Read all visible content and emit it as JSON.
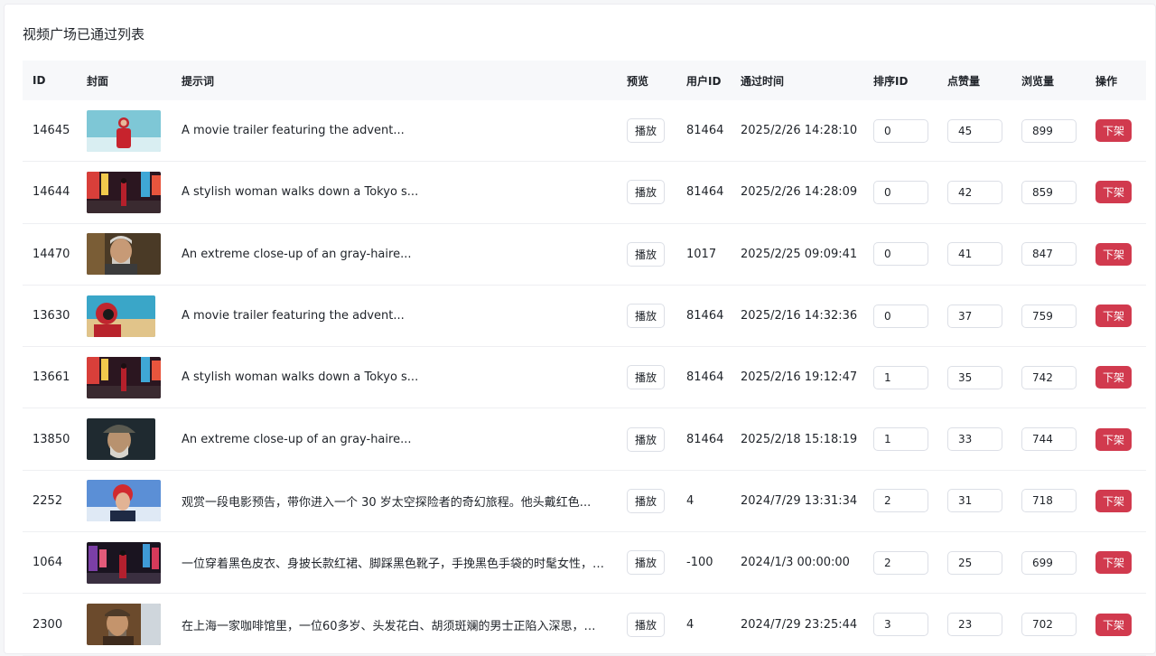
{
  "page": {
    "title": "视频广场已通过列表"
  },
  "table": {
    "headers": [
      "ID",
      "封面",
      "提示词",
      "预览",
      "用户ID",
      "通过时间",
      "排序ID",
      "点赞量",
      "浏览量",
      "操作"
    ],
    "play_label": "播放",
    "takedown_label": "下架",
    "rows": [
      {
        "id": "14645",
        "prompt": "A movie trailer featuring the advent...",
        "user_id": "81464",
        "time": "2025/2/26 14:28:10",
        "order": "0",
        "likes": "45",
        "views": "899",
        "thumb": "astronaut-snow"
      },
      {
        "id": "14644",
        "prompt": "A stylish woman walks down a Tokyo s...",
        "user_id": "81464",
        "time": "2025/2/26 14:28:09",
        "order": "0",
        "likes": "42",
        "views": "859",
        "thumb": "tokyo-street"
      },
      {
        "id": "14470",
        "prompt": "An extreme close-up of an gray-haire...",
        "user_id": "1017",
        "time": "2025/2/25 09:09:41",
        "order": "0",
        "likes": "41",
        "views": "847",
        "thumb": "old-man"
      },
      {
        "id": "13630",
        "prompt": "A movie trailer featuring the advent...",
        "user_id": "81464",
        "time": "2025/2/16 14:32:36",
        "order": "0",
        "likes": "37",
        "views": "759",
        "thumb": "astronaut-desert"
      },
      {
        "id": "13661",
        "prompt": "A stylish woman walks down a Tokyo s...",
        "user_id": "81464",
        "time": "2025/2/16 19:12:47",
        "order": "1",
        "likes": "35",
        "views": "742",
        "thumb": "tokyo-street"
      },
      {
        "id": "13850",
        "prompt": "An extreme close-up of an gray-haire...",
        "user_id": "81464",
        "time": "2025/2/18 15:18:19",
        "order": "1",
        "likes": "33",
        "views": "744",
        "thumb": "old-man-hat"
      },
      {
        "id": "2252",
        "prompt": "观赏一段电影预告，带你进入一个 30 岁太空探险者的奇幻旅程。他头戴红色...",
        "user_id": "4",
        "time": "2024/7/29 13:31:34",
        "order": "2",
        "likes": "31",
        "views": "718",
        "thumb": "red-helmet"
      },
      {
        "id": "1064",
        "prompt": "一位穿着黑色皮衣、身披长款红裙、脚踩黑色靴子，手挽黑色手袋的时髦女性，在...",
        "user_id": "-100",
        "time": "2024/1/3 00:00:00",
        "order": "2",
        "likes": "25",
        "views": "699",
        "thumb": "night-street"
      },
      {
        "id": "2300",
        "prompt": "在上海一家咖啡馆里，一位60多岁、头发花白、胡须斑斓的男士正陷入深思，他...",
        "user_id": "4",
        "time": "2024/7/29 23:25:44",
        "order": "3",
        "likes": "23",
        "views": "702",
        "thumb": "cafe-man"
      }
    ]
  }
}
